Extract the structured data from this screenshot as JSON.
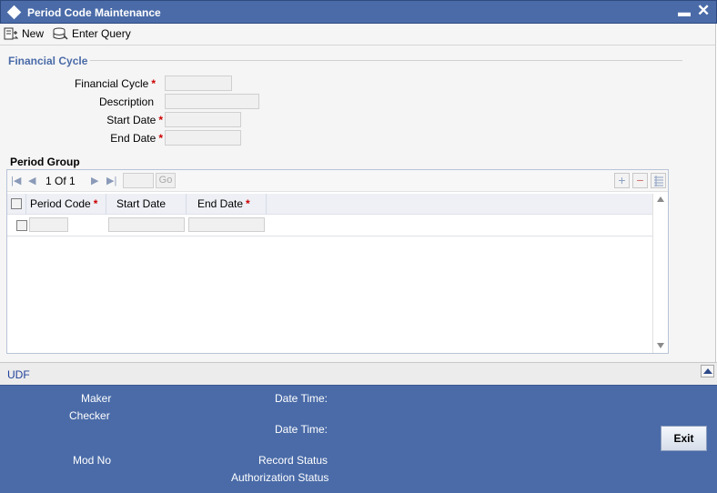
{
  "window": {
    "title": "Period Code Maintenance",
    "minimize_glyph": "▬",
    "close_glyph": "✕"
  },
  "toolbar": {
    "new_label": "New",
    "enter_query_label": "Enter Query"
  },
  "financial_cycle_section": {
    "title": "Financial Cycle",
    "fields": [
      {
        "label": "Financial Cycle",
        "required": true,
        "value": ""
      },
      {
        "label": "Description",
        "required": false,
        "value": ""
      },
      {
        "label": "Start Date",
        "required": true,
        "value": ""
      },
      {
        "label": "End Date",
        "required": true,
        "value": ""
      }
    ],
    "required_mark": "*"
  },
  "period_group": {
    "title": "Period Group",
    "pagination": {
      "current": "1",
      "of_label": "Of",
      "total": "1",
      "go_label": "Go"
    },
    "columns": [
      {
        "label": "Period Code",
        "required": true
      },
      {
        "label": "Start Date",
        "required": false
      },
      {
        "label": "End Date",
        "required": true
      }
    ],
    "rows": [
      {
        "period_code": "",
        "start_date": "",
        "end_date": ""
      }
    ]
  },
  "udf": {
    "label": "UDF"
  },
  "footer": {
    "maker_label": "Maker",
    "checker_label": "Checker",
    "mod_no_label": "Mod No",
    "date_time_label_1": "Date Time:",
    "date_time_label_2": "Date Time:",
    "record_status_label": "Record Status",
    "authorization_status_label": "Authorization Status",
    "exit_label": "Exit"
  },
  "colors": {
    "title_bar": "#4a6ba8",
    "section_title": "#4a6ba8",
    "required": "#cc0000",
    "footer": "#4a6ba8"
  }
}
